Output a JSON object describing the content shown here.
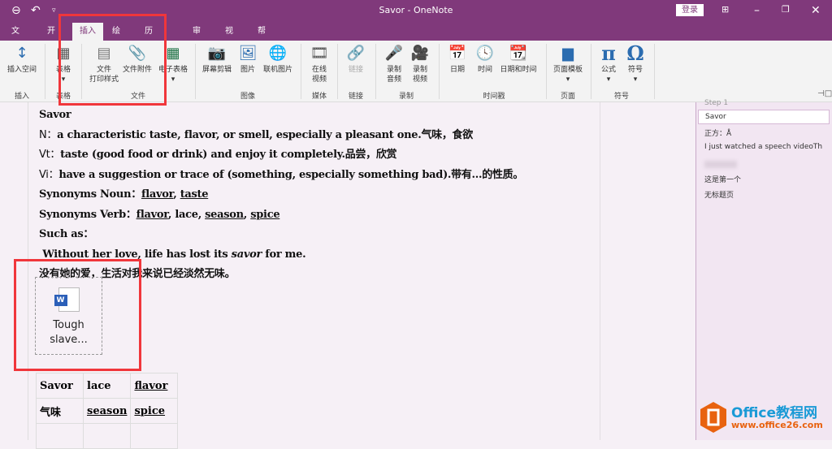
{
  "titlebar": {
    "title": "Savor  -  OneNote",
    "login": "登录",
    "icons": [
      "back-icon",
      "undo-icon",
      "customize-icon",
      "ribbon-display-icon",
      "minimize-icon",
      "restore-icon",
      "close-icon"
    ]
  },
  "tabs": [
    "文件",
    "开始",
    "插入",
    "绘图",
    "历史记录",
    "审阅",
    "视图",
    "帮助"
  ],
  "ribbon": {
    "buttons": {
      "insert_space": "插入空间",
      "table": "表格",
      "printout_1": "文件",
      "printout_2": "打印样式",
      "attachment": "文件附件",
      "spreadsheet": "电子表格",
      "screen_clip": "屏幕剪辑",
      "picture": "图片",
      "online_picture": "联机图片",
      "online_video_1": "在线",
      "online_video_2": "视频",
      "link": "链接",
      "audio_1": "录制",
      "audio_2": "音频",
      "video_1": "录制",
      "video_2": "视频",
      "date": "日期",
      "time": "时间",
      "datetime": "日期和时间",
      "page_template": "页面模板",
      "equation": "公式",
      "symbol": "符号"
    },
    "groups": {
      "insert": "插入",
      "tables": "表格",
      "files": "文件",
      "images": "图像",
      "media": "媒体",
      "links": "链接",
      "recording": "录制",
      "timestamp": "时间戳",
      "pages": "页面",
      "symbols": "符号"
    }
  },
  "note": {
    "title": "Savor",
    "n_label": "N：",
    "n_text": "a characteristic taste, flavor, or smell, especially a pleasant one.气味，食欲",
    "vt_label": "Vt：",
    "vt_text": "taste (good food or drink) and enjoy it completely.品尝，欣赏",
    "vi_label": "Vi：",
    "vi_text": "have a suggestion or trace of (something, especially something bad).带有…的性质。",
    "syn_noun_label": "Synonyms Noun：",
    "syn_noun": [
      "flavor",
      "taste"
    ],
    "syn_verb_label": "Synonyms Verb：",
    "syn_verb": [
      "flavor",
      "lace",
      "season",
      "spice"
    ],
    "such_as": "Such as：",
    "example_pre": " Without her love, life has lost its ",
    "example_em": "savor",
    "example_post": " for me.",
    "example_cn": "没有她的爱，生活对我来说已经淡然无味。",
    "attachment": {
      "line1": "Tough",
      "line2": "slave..."
    },
    "table": [
      [
        "Savor",
        "lace",
        "flavor"
      ],
      [
        "气味",
        "season",
        "spice"
      ]
    ]
  },
  "pages": {
    "partial": "Step 1",
    "items": [
      "Savor",
      "正方：Å",
      "I just watched a speech videoTh",
      "这是第一个",
      "无标题页"
    ],
    "selected": "Savor"
  },
  "watermark": {
    "brand": "Office教程网",
    "url": "www.office26.com"
  }
}
